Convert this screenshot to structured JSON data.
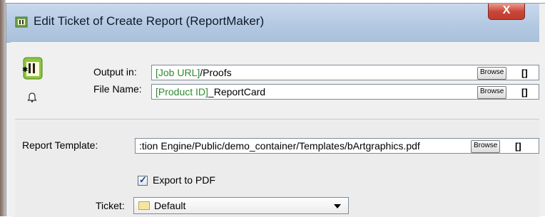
{
  "window": {
    "title": "Edit Ticket of Create Report (ReportMaker)",
    "close_label": "X"
  },
  "output_in": {
    "label": "Output in:",
    "value_variable": "[Job URL]",
    "value_text": "/Proofs",
    "browse_label": "Browse",
    "extra_label": "[]"
  },
  "file_name": {
    "label": "File Name:",
    "value_variable": "[Product ID]",
    "value_text": "_ReportCard",
    "browse_label": "Browse",
    "extra_label": "[]"
  },
  "report_template": {
    "label": "Report Template:",
    "value": ":tion Engine/Public/demo_container/Templates/bArtgraphics.pdf",
    "browse_label": "Browse",
    "extra_label": "[]"
  },
  "export_pdf": {
    "label": "Export to PDF",
    "checked": true
  },
  "ticket": {
    "label": "Ticket:",
    "selected": "Default"
  },
  "colors": {
    "variable_green": "#2f8a2f",
    "title_bar": "#b4c9e2",
    "close_red": "#c8473a"
  },
  "icons": [
    "app-ticket-icon",
    "close-icon",
    "report-maker-icon",
    "bell-icon",
    "ticket-icon",
    "chevron-down-icon"
  ]
}
